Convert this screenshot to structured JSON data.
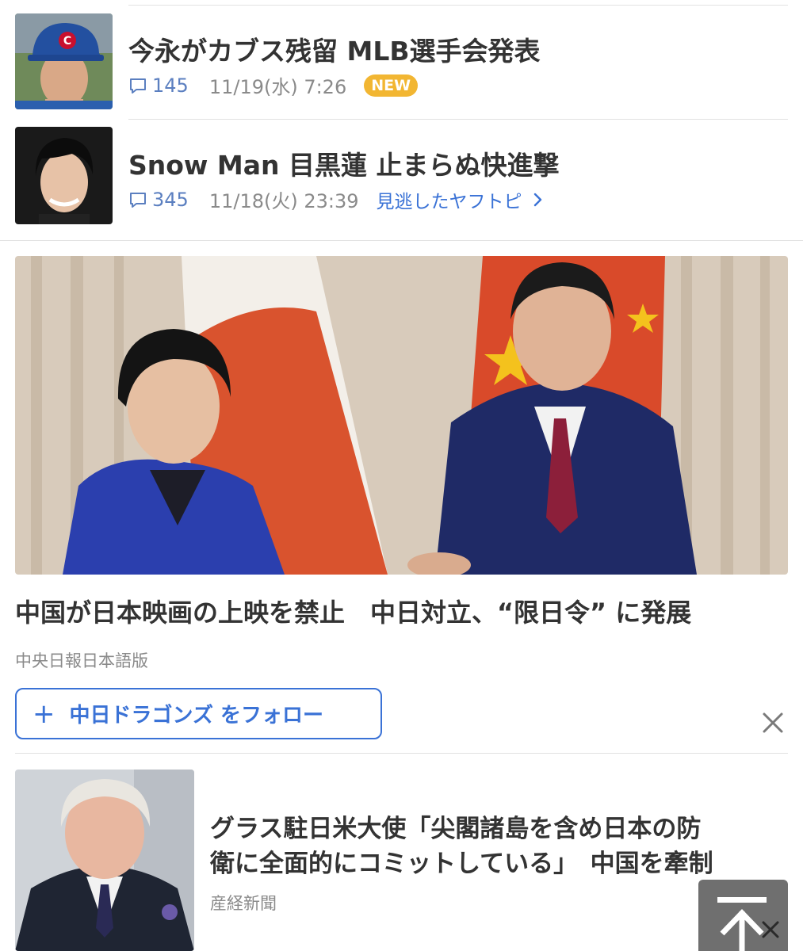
{
  "articles": [
    {
      "headline": "今永がカブス残留 MLB選手会発表",
      "comments": "145",
      "timestamp": "11/19(水) 7:26",
      "badge": "NEW"
    },
    {
      "headline": "Snow Man 目黒蓮 止まらぬ快進撃",
      "comments": "345",
      "timestamp": "11/18(火) 23:39",
      "link_label": "見逃したヤフトピ"
    }
  ],
  "feature": {
    "headline": "中国が日本映画の上映を禁止　中日対立、“限日令” に発展",
    "source": "中央日報日本語版"
  },
  "follow": {
    "plus": "+",
    "label": "中日ドラゴンズ をフォロー"
  },
  "next_article": {
    "headline_line1": "グラス駐日米大使「尖閣諸島を含め日本の防",
    "headline_line2": "衛に全面的にコミットしている」　中国を牽制",
    "source": "産経新聞"
  },
  "icons": {
    "comment": "comment-bubble-icon",
    "chevron": "chevron-right-icon",
    "close": "close-icon",
    "scroll_top": "scroll-to-top-icon"
  },
  "colors": {
    "accent": "#3a72d6",
    "comment": "#5b7fc0",
    "badge": "#f2b632"
  }
}
